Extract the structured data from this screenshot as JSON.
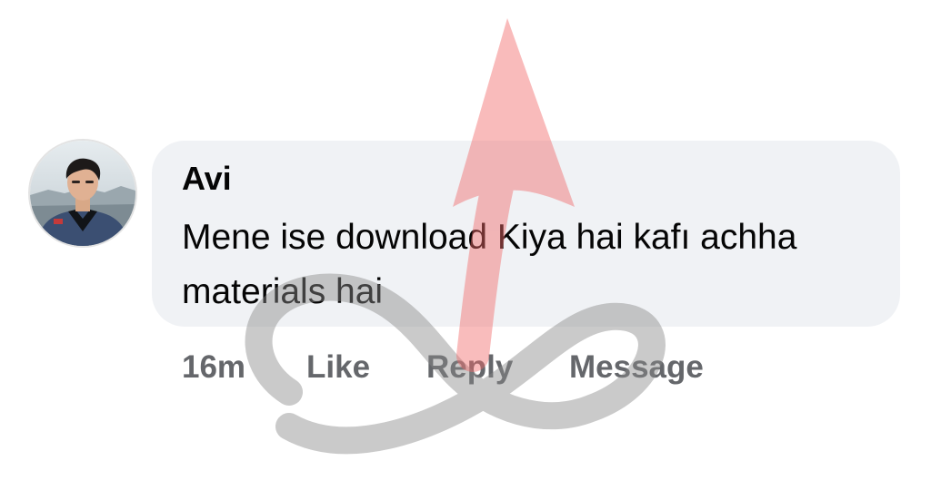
{
  "comment": {
    "author": "Avi",
    "text": "Mene ise download Kiya hai kafı achha materials hai",
    "time": "16m",
    "actions": {
      "like": "Like",
      "reply": "Reply",
      "message": "Message"
    }
  },
  "colors": {
    "bubble_background": "#f0f2f5",
    "text_primary": "#050505",
    "text_secondary": "#65676b",
    "watermark_arrow": "#f26b6b",
    "watermark_loop": "#8a8a8a"
  },
  "icons": {
    "avatar": "profile-photo",
    "watermark": "infinity-arrow-logo"
  }
}
